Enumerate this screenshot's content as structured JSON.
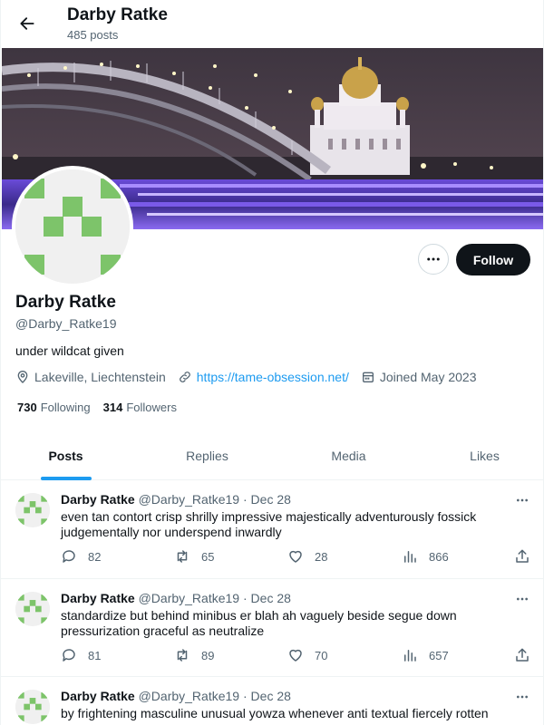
{
  "header": {
    "name": "Darby Ratke",
    "post_count": "485 posts"
  },
  "profile": {
    "name": "Darby Ratke",
    "handle": "@Darby_Ratke19",
    "bio": "under wildcat given",
    "location": "Lakeville, Liechtenstein",
    "website": "https://tame-obsession.net/",
    "joined": "Joined May 2023",
    "following_count": "730",
    "following_label": "Following",
    "followers_count": "314",
    "followers_label": "Followers",
    "follow_label": "Follow"
  },
  "tabs": [
    {
      "label": "Posts",
      "active": true
    },
    {
      "label": "Replies",
      "active": false
    },
    {
      "label": "Media",
      "active": false
    },
    {
      "label": "Likes",
      "active": false
    }
  ],
  "posts": [
    {
      "name": "Darby Ratke",
      "handle": "@Darby_Ratke19",
      "separator": "·",
      "date": "Dec 28",
      "text": "even tan contort crisp shrilly impressive majestically adventurously fossick judgementally nor underspend inwardly",
      "replies": "82",
      "reposts": "65",
      "likes": "28",
      "views": "866"
    },
    {
      "name": "Darby Ratke",
      "handle": "@Darby_Ratke19",
      "separator": "·",
      "date": "Dec 28",
      "text": "standardize but behind minibus er blah ah vaguely beside segue down pressurization graceful as neutralize",
      "replies": "81",
      "reposts": "89",
      "likes": "70",
      "views": "657"
    },
    {
      "name": "Darby Ratke",
      "handle": "@Darby_Ratke19",
      "separator": "·",
      "date": "Dec 28",
      "text": "by frightening masculine unusual yowza whenever anti textual fiercely rotten"
    }
  ],
  "icons": {
    "back": "arrow-left-icon",
    "more": "more-horizontal-icon",
    "location": "location-pin-icon",
    "link": "link-icon",
    "calendar": "calendar-icon",
    "reply": "reply-icon",
    "repost": "repost-icon",
    "like": "heart-icon",
    "views": "views-chart-icon",
    "share": "share-icon"
  },
  "colors": {
    "accent": "#1d9bf0",
    "text": "#0f1419",
    "muted": "#536471",
    "avatar_green": "#7dc46a",
    "follow_bg": "#0f1419"
  }
}
